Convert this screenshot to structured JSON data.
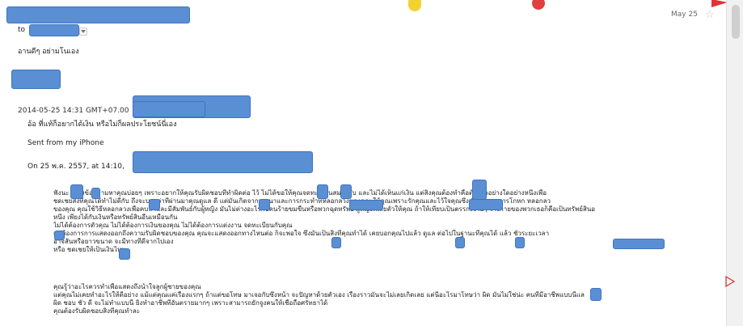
{
  "header": {
    "date": "May 25",
    "to_label": "to",
    "snippet": "อานดีๆ อย่ามโนเอง"
  },
  "quoted": {
    "meta_line": "2014-05-25 14:31 GMT+07.00",
    "reply_line": "อ้อ ที่แท้ก็อยากได้เงิน หรือไม่ก็ผลประโยชน์นี่เอง",
    "sent_from": "Sent from my iPhone",
    "on_line": "On 25 พ.ค. 2557, at 14:10,"
  },
  "body": {
    "paragraph1": [
      "ฟังนะ       ที่      ส่งข้อความหาคุณบ่อยๆ เพราะอยากให้คุณรับผิดชอบที่ทำผิดต่อ       ไว้       ไม่ได้ขอให้คุณจดทะเบียนสมรสกับ       และไม่ได้เห็นแก่เงิน แต่สิ่งคุณต้องทำคือต้องทำอย่างใดอย่างหนึ่งเพื่อ",
      "ชดเชยสิ่งที่คุณได้ทำไม่ดีกับ       ถึงจะบอกว่าที่ผ่านมาคุณดูแล       ดี แต่มันเกิดจากเจตนาและการกระทำที่หลอกลวงของคุณ                  ให้คุณเพราะรักคุณและไว้ใจคุณซึ่งเกิดมาจากการโกหก หลอกลว",
      "ของคุณ คุณใช้วิธีหลอกลวงเพื่อคบหาและมีสัมพันธ์กับผู้หญิง มันไม่ต่างอะไรกับคนร้ายขมขืนหรือพวกฉุดทรัพย์ ผู้หญิงที่เสียตัวให้คุณ ถ้าให้เทียบเป็นตรรกะง่ายๆ รางกายของพวกเธอก็คือเป็นทรัพย์สินอ",
      "หนึ่ง เพียงได้กับเงินหรือทรัพย์สินอื่นเหมือนกัน",
      "      ไม่ได้ต้องการตัวคุณ ไม่ได้ต้องการเงินของคุณ ไม่ได้ต้องการแต่งงาน จดทะเบียนกับคุณ",
      "แต่ต้องการการแสดงออกถึงความรับผิดชอบของคุณ คุณจะแสดงออกทางไหนต่อ       ก็จะพอใจ ซึ่งมันเป็นสิ่งที่คุณทำได้       เคยบอกคุณไปแล้ว ดูแล       ต่อไปในฐานะที่คุณได้             แล้ว ชั่วระยะเวลา",
      "อาจสั้นหรือยาวขนาด       จะมีทางที่ดีจากไปเอง",
      "หรือ ชดเชยให้เป็นเงินไหม"
    ],
    "paragraph2": [
      "คุณรู้ว่าอะไรควรทำเพื่อแสดงถึงน้ำใจลูกผู้ชายของคุณ",
      "แต่คุณไม่เคยทำอะไรให้ดีอย่าง แม้แต่คุณแค่เรื่องแรกๆ ถ้าแต่ขอโทษ มาเจอกับซึ่งหน้า จะปัญหาด้วยตัวเอง เรื่องราวมันจะไม่เลยเกิดเลย แต่นี่อะไรมาโทษว่า       ผิด มันไม่ใช่น่ะ คนที่มีอาชีพแบบนี้แล",
      "ผิด ชอบ ชั่ว ดี จะไม่ทำแบบนี้ ยิ่งทำอาชีพที่อันตรายมากๆ เพราะสามารถยักจูงคนให้เชื่อถือศรัทธาได้",
      "คุณต้องรับผิดชอบสิ่งที่คุณทำละ"
    ]
  },
  "colors": {
    "redaction": "#5b8fd4",
    "text": "#222222",
    "date_gray": "#666666"
  }
}
